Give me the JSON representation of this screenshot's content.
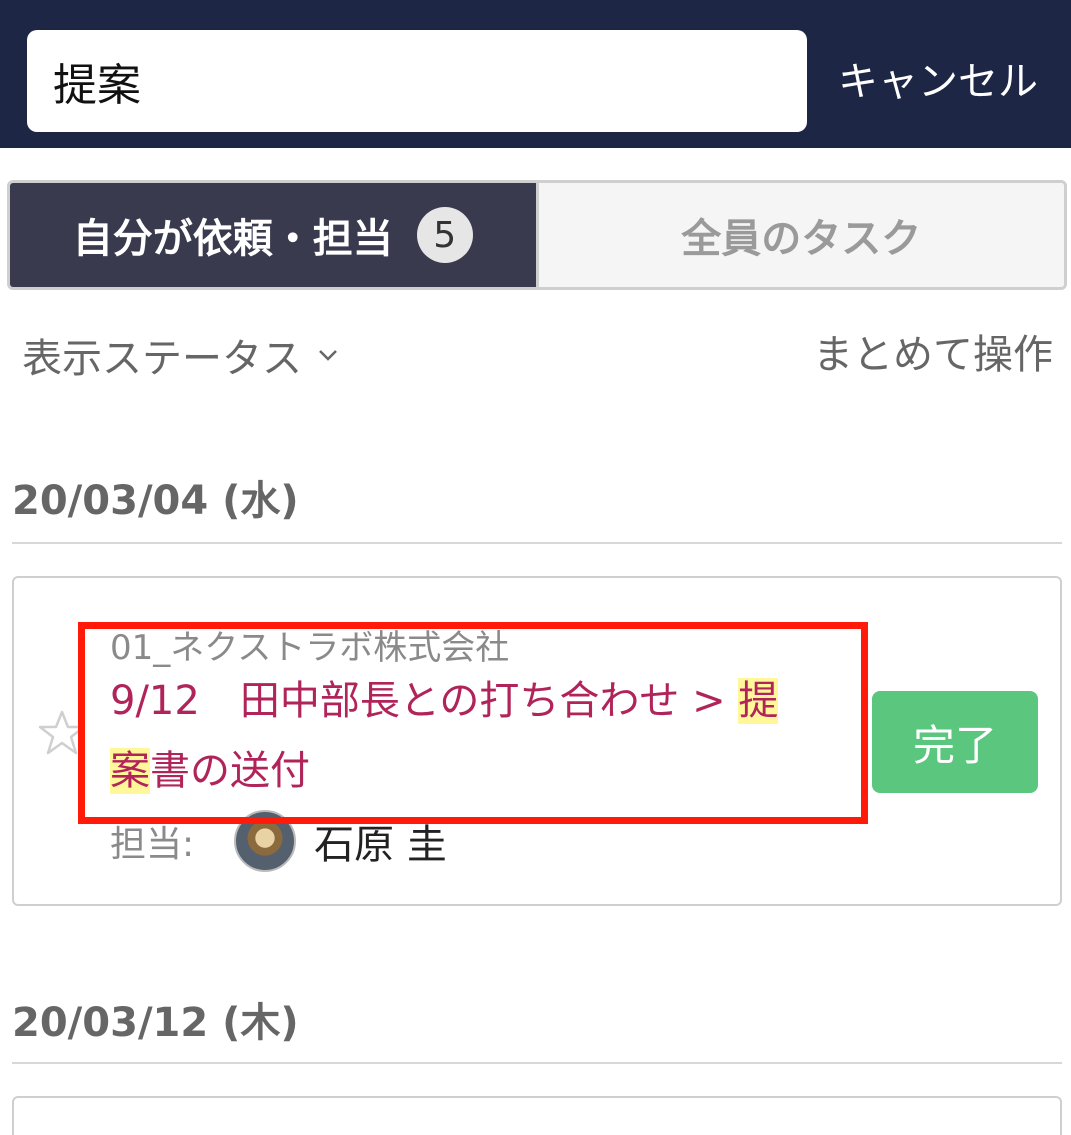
{
  "header": {
    "search_value": "提案",
    "cancel_label": "キャンセル",
    "bg_color": "#1d2645"
  },
  "segments": {
    "mine_label": "自分が依頼・担当",
    "mine_count": "5",
    "all_label": "全員のタスク"
  },
  "toolbar": {
    "status_filter_label": "表示ステータス",
    "bulk_action_label": "まとめて操作"
  },
  "groups": [
    {
      "date": "20/03/04 (水)",
      "tasks": [
        {
          "company": "01_ネクストラボ株式会社",
          "title_before": "9/12　田中部長との打ち合わせ > ",
          "title_highlight_1": "提",
          "title_highlight_2": "案",
          "title_after": "書の送付",
          "assignee_label": "担当:",
          "assignee_name": "石原 圭",
          "done_label": "完了"
        }
      ]
    },
    {
      "date": "20/03/12 (木)"
    }
  ],
  "colors": {
    "active_tab": "#3a3a4f",
    "task_title": "#b0245a",
    "highlight": "#fff79a",
    "done_button": "#5bc67d",
    "annotation_box": "#ff1a0a"
  },
  "icons": {
    "star": "star-outline-icon",
    "chevron": "chevron-down-icon"
  }
}
